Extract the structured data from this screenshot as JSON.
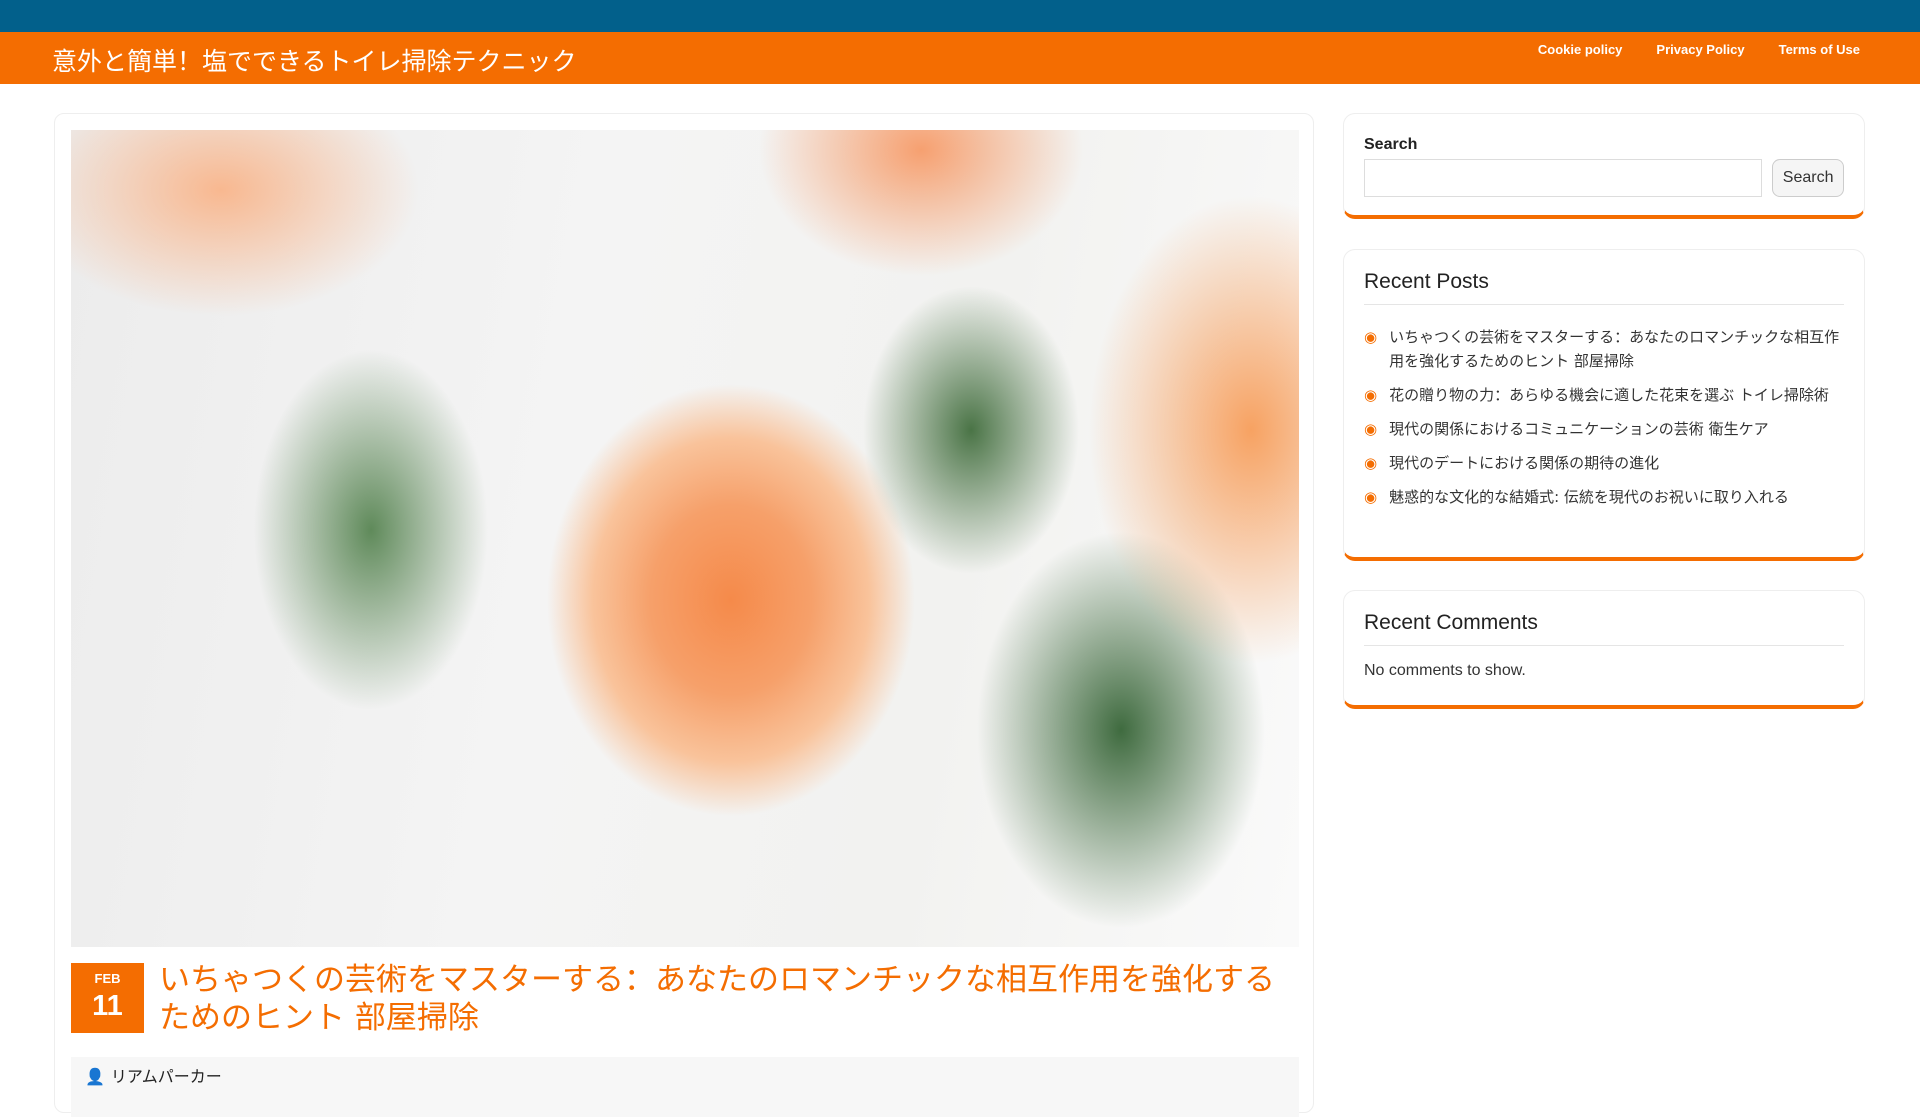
{
  "site": {
    "title": "意外と簡単！塩でできるトイレ掃除テクニック",
    "nav": [
      "Cookie policy",
      "Privacy Policy",
      "Terms of Use"
    ],
    "accent": "#f46d01",
    "topbar": "#02608b"
  },
  "post": {
    "month": "FEB",
    "day": "11",
    "title": "いちゃつくの芸術をマスターする：あなたのロマンチックな相互作用を強化するためのヒント 部屋掃除",
    "author": "リアムパーカー",
    "author_icon": "user-icon"
  },
  "sidebar": {
    "search": {
      "label": "Search",
      "button": "Search",
      "value": ""
    },
    "recent_posts": {
      "title": "Recent Posts",
      "items": [
        "いちゃつくの芸術をマスターする：あなたのロマンチックな相互作用を強化するためのヒント 部屋掃除",
        "花の贈り物の力：あらゆる機会に適した花束を選ぶ トイレ掃除術",
        "現代の関係におけるコミュニケーションの芸術 衛生ケア",
        "現代のデートにおける関係の期待の進化",
        "魅惑的な文化的な結婚式: 伝統を現代のお祝いに取り入れる"
      ]
    },
    "recent_comments": {
      "title": "Recent Comments",
      "empty": "No comments to show."
    }
  }
}
